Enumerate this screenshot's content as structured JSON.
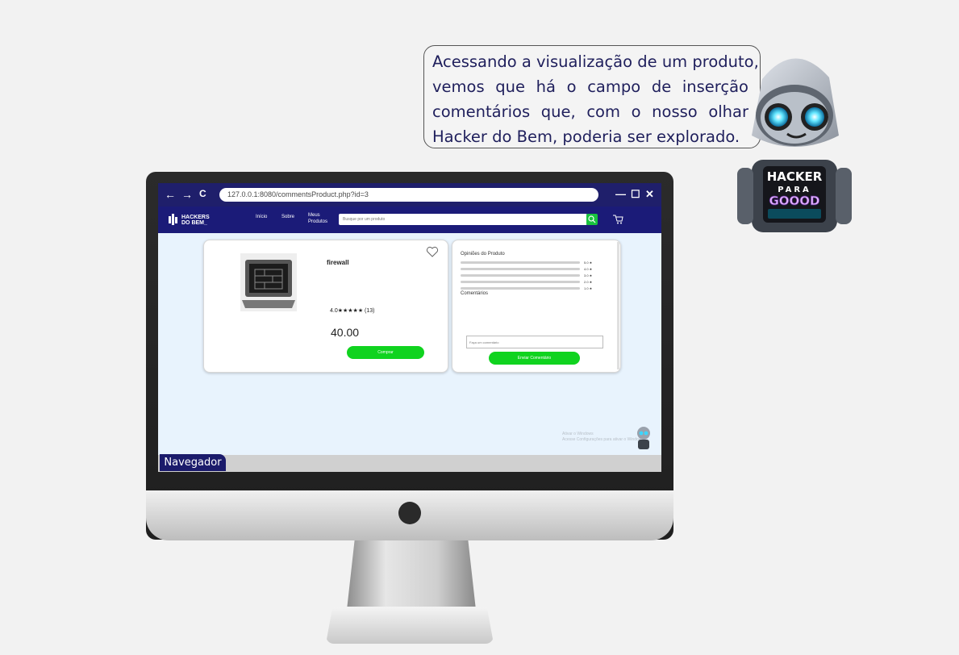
{
  "bubble": {
    "lines": [
      "Acessando a visualização de um produto,",
      "vemos que há o campo de inserção",
      "comentários que, com o nosso olhar",
      "Hacker do Bem, poderia ser explorado."
    ]
  },
  "robot": {
    "badge_line1": "HACKER",
    "badge_line2": "PARA",
    "badge_line3": "GOOOD"
  },
  "browser": {
    "back": "←",
    "forward": "→",
    "reload": "C",
    "url": "127.0.0.1:8080/commentsProduct.php?id=3",
    "minimize": "—",
    "maximize": "☐",
    "close": "✕"
  },
  "site": {
    "logo_line1": "HACKERS",
    "logo_line2": "DO BEM_",
    "menu": [
      "Início",
      "Sobre",
      "Meus",
      "Produtos"
    ],
    "search_placeholder": "Busque por um produto"
  },
  "product": {
    "name": "firewall",
    "rating_text": "4.0★★★★★ (13)",
    "price": "40.00",
    "buy_label": "Comprar"
  },
  "reviews": {
    "title": "Opiniões do Produto",
    "bars": [
      "5.0 ★",
      "4.0 ★",
      "3.0 ★",
      "2.0 ★",
      "1.0 ★"
    ],
    "comments_title": "Comentários",
    "comment_placeholder": "Faça um comentário",
    "send_label": "Enviar Comentário"
  },
  "watermark": {
    "line1": "Ativar o Windows",
    "line2": "Acesse Configurações para ativar o Windows."
  },
  "taskbar": {
    "label": "Navegador"
  },
  "colors": {
    "navy": "#1b1b78",
    "green": "#10d31f",
    "bubble_text": "#1f1f5c"
  }
}
